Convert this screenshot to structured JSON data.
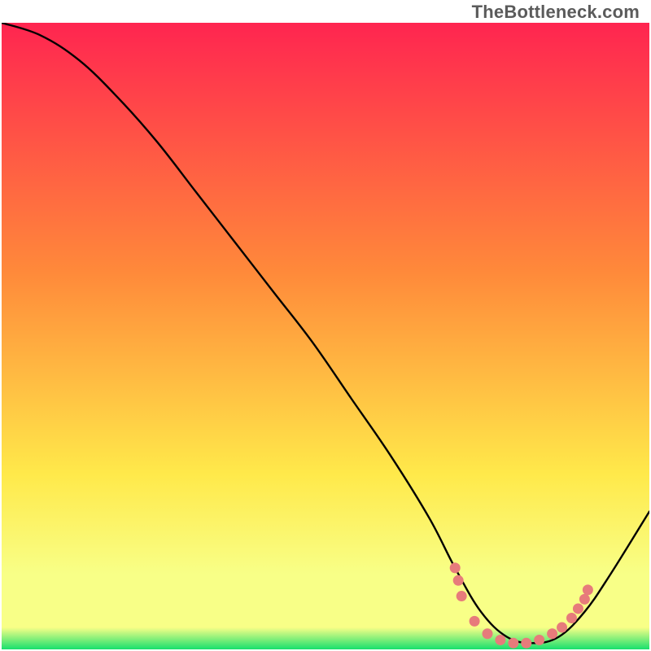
{
  "watermark": "TheBottleneck.com",
  "gradient": {
    "top": "#ff2550",
    "mid1": "#ff8a3a",
    "mid2": "#ffe94a",
    "band": "#f8ff87",
    "bottom": "#18e06e"
  },
  "chart_data": {
    "type": "line",
    "title": "",
    "xlabel": "",
    "ylabel": "",
    "xlim": [
      0,
      100
    ],
    "ylim": [
      0,
      100
    ],
    "grid": false,
    "legend": "none",
    "series": [
      {
        "name": "primary-curve",
        "x": [
          0,
          6,
          12,
          18,
          24,
          30,
          36,
          42,
          48,
          54,
          60,
          66,
          70,
          74,
          78,
          82,
          86,
          90,
          94,
          100
        ],
        "values": [
          100,
          98,
          94,
          88,
          81,
          73,
          65,
          57,
          49,
          40,
          31,
          21,
          13,
          6,
          2,
          1,
          2,
          6,
          12,
          22
        ]
      },
      {
        "name": "salmon-dots",
        "x": [
          70.0,
          70.5,
          71.0,
          73.0,
          75.0,
          77.0,
          79.0,
          81.0,
          83.0,
          85.0,
          86.5,
          88.0,
          89.0,
          90.0,
          90.5
        ],
        "values": [
          13.0,
          11.0,
          8.5,
          4.5,
          2.5,
          1.5,
          1.0,
          1.0,
          1.5,
          2.5,
          3.5,
          5.0,
          6.5,
          8.0,
          9.5
        ]
      }
    ]
  }
}
